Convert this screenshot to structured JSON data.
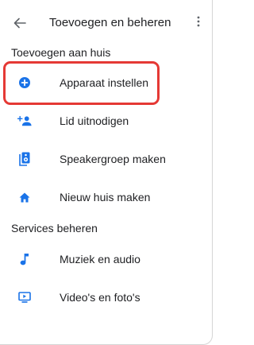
{
  "app_bar": {
    "title": "Toevoegen en beheren",
    "back_icon": "arrow-left-icon",
    "more_icon": "more-vertical-icon"
  },
  "sections": [
    {
      "header": "Toevoegen aan huis",
      "items": [
        {
          "label": "Apparaat instellen",
          "icon": "add-circle-icon",
          "highlighted": true
        },
        {
          "label": "Lid uitnodigen",
          "icon": "person-add-icon"
        },
        {
          "label": "Speakergroep maken",
          "icon": "speaker-group-icon"
        },
        {
          "label": "Nieuw huis maken",
          "icon": "home-icon"
        }
      ]
    },
    {
      "header": "Services beheren",
      "items": [
        {
          "label": "Muziek en audio",
          "icon": "music-note-icon"
        },
        {
          "label": "Video's en foto's",
          "icon": "video-screen-icon"
        }
      ]
    }
  ],
  "colors": {
    "icon_blue": "#1a73e8",
    "highlight_red": "#e53935",
    "accent_yellow": "#f5c518",
    "text": "#202124"
  }
}
